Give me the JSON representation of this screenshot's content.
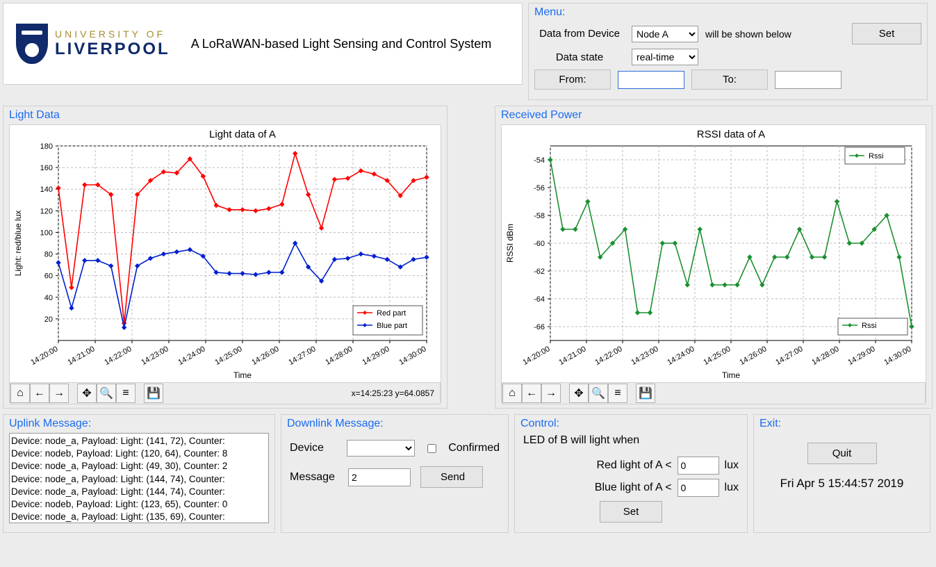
{
  "header": {
    "uni_line1": "UNIVERSITY OF",
    "uni_line2": "LIVERPOOL",
    "app_title": "A LoRaWAN-based Light Sensing and Control System"
  },
  "menu": {
    "title": "Menu:",
    "device_label": "Data from Device",
    "device_selected": "Node A",
    "device_suffix": "will be shown below",
    "state_label": "Data state",
    "state_selected": "real-time",
    "set_btn": "Set",
    "from_label": "From:",
    "from_value": "",
    "to_label": "To:",
    "to_value": ""
  },
  "light_panel": {
    "title": "Light Data"
  },
  "rssi_panel": {
    "title": "Received Power"
  },
  "chart_data": [
    {
      "type": "line",
      "title": "Light data of A",
      "xlabel": "Time",
      "ylabel": "Light: red/blue     lux",
      "categories": [
        "14:20:00",
        "14:21:00",
        "14:22:00",
        "14:23:00",
        "14:24:00",
        "14:25:00",
        "14:26:00",
        "14:27:00",
        "14:28:00",
        "14:29:00",
        "14:30:00"
      ],
      "ylim": [
        0,
        180
      ],
      "yticks": [
        20,
        40,
        60,
        80,
        100,
        120,
        140,
        160,
        180
      ],
      "series": [
        {
          "name": "Red part",
          "color": "#ff0000",
          "values": [
            141,
            49,
            144,
            144,
            135,
            16,
            135,
            148,
            156,
            155,
            168,
            152,
            125,
            121,
            121,
            120,
            122,
            126,
            173,
            135,
            104,
            149,
            150,
            157,
            154,
            148,
            134,
            148,
            151
          ]
        },
        {
          "name": "Blue part",
          "color": "#0020d0",
          "values": [
            72,
            30,
            74,
            74,
            69,
            12,
            69,
            76,
            80,
            82,
            84,
            78,
            63,
            62,
            62,
            61,
            63,
            63,
            90,
            68,
            55,
            75,
            76,
            80,
            78,
            75,
            68,
            75,
            77
          ]
        }
      ],
      "toolbar_status": "x=14:25:23 y=64.0857"
    },
    {
      "type": "line",
      "title": "RSSI data of A",
      "xlabel": "Time",
      "ylabel": "RSSI     dBm",
      "categories": [
        "14:20:00",
        "14:21:00",
        "14:22:00",
        "14:23:00",
        "14:24:00",
        "14:25:00",
        "14:26:00",
        "14:27:00",
        "14:28:00",
        "14:29:00",
        "14:30:00"
      ],
      "ylim": [
        -67,
        -53
      ],
      "yticks": [
        -66,
        -64,
        -62,
        -60,
        -58,
        -56,
        -54
      ],
      "series": [
        {
          "name": "Rssi",
          "color": "#1a9030",
          "values": [
            -54,
            -59,
            -59,
            -57,
            -61,
            -60,
            -59,
            -65,
            -65,
            -60,
            -60,
            -63,
            -59,
            -63,
            -63,
            -63,
            -61,
            -63,
            -61,
            -61,
            -59,
            -61,
            -61,
            -57,
            -60,
            -60,
            -59,
            -58,
            -61,
            -66
          ]
        }
      ],
      "toolbar_status": ""
    }
  ],
  "uplink": {
    "title": "Uplink Message:",
    "items": [
      "Device: node_a, Payload: Light: (141, 72), Counter:",
      "Device: nodeb, Payload: Light: (120, 64), Counter: 8",
      "Device: node_a, Payload: Light: (49, 30), Counter: 2",
      "Device: node_a, Payload: Light: (144, 74), Counter:",
      "Device: node_a, Payload: Light: (144, 74), Counter:",
      "Device: nodeb, Payload: Light: (123, 65), Counter: 0",
      "Device: node_a, Payload: Light: (135, 69), Counter:"
    ]
  },
  "downlink": {
    "title": "Downlink Message:",
    "device_label": "Device",
    "device_selected": "",
    "confirmed_label": "Confirmed",
    "confirmed": false,
    "message_label": "Message",
    "message_value": "2",
    "send_btn": "Send"
  },
  "control": {
    "title": "Control:",
    "heading": "LED of B will light when",
    "red_label": "Red light of A <",
    "red_value": "0",
    "blue_label": "Blue light of A <",
    "blue_value": "0",
    "unit": "lux",
    "set_btn": "Set"
  },
  "exit": {
    "title": "Exit:",
    "quit_btn": "Quit",
    "timestamp": "Fri Apr  5 15:44:57 2019"
  },
  "toolbar_icons": {
    "home": "⌂",
    "back": "←",
    "forward": "→",
    "pan": "✥",
    "zoom": "🔍",
    "config": "≡",
    "save": "💾"
  }
}
